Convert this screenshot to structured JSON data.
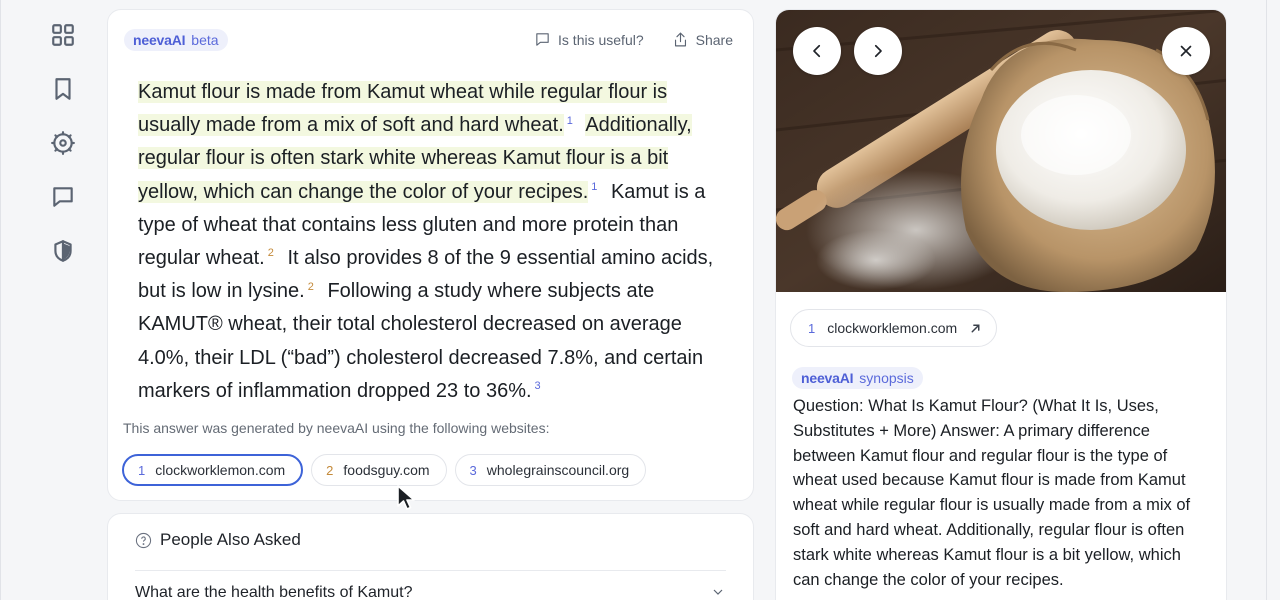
{
  "rail": {
    "icons": [
      "apps-grid-icon",
      "bookmark-icon",
      "settings-gear-icon",
      "feedback-chat-icon",
      "privacy-shield-icon"
    ]
  },
  "answer": {
    "brand": "neevaAI",
    "tag": "beta",
    "useful_label": "Is this useful?",
    "share_label": "Share",
    "segments": [
      {
        "text": "Kamut flour is made from Kamut wheat while regular flour is usually made from a mix of soft and hard wheat.",
        "cite": "1",
        "highlight": true
      },
      {
        "text": "Additionally, regular flour is often stark white whereas Kamut flour is a bit yellow, which can change the color of your recipes.",
        "cite": "1",
        "highlight": true
      },
      {
        "text": "Kamut is a type of wheat that contains less gluten and more protein than regular wheat.",
        "cite": "2",
        "highlight": false
      },
      {
        "text": "It also provides 8 of the 9 essential amino acids, but is low in lysine.",
        "cite": "2",
        "highlight": false
      },
      {
        "text": "Following a study where subjects ate KAMUT® wheat, their total cholesterol decreased on average 4.0%, their LDL (“bad”) cholesterol decreased 7.8%, and certain markers of inflammation dropped 23 to 36%.",
        "cite": "3",
        "highlight": false
      }
    ],
    "generated_note": "This answer was generated by neevaAI using the following websites:",
    "sources": [
      {
        "num": "1",
        "name": "clockworklemon.com"
      },
      {
        "num": "2",
        "name": "foodsguy.com"
      },
      {
        "num": "3",
        "name": "wholegrainscouncil.org"
      }
    ]
  },
  "paa": {
    "title": "People Also Asked",
    "question": "What are the health benefits of Kamut?"
  },
  "panel": {
    "source_num": "1",
    "source_name": "clockworklemon.com",
    "brand": "neevaAI",
    "tag": "synopsis",
    "synopsis": "Question: What Is Kamut Flour? (What It Is, Uses, Substitutes + More) Answer: A primary difference between Kamut flour and regular flour is the type of wheat used because Kamut flour is made from Kamut wheat while regular flour is usually made from a mix of soft and hard wheat. Additionally, regular flour is often stark white whereas Kamut flour is a bit yellow, which can change the color of your recipes."
  },
  "colors": {
    "accent": "#4e5fd6",
    "highlight": "#f3f8e0",
    "active_border": "#3d63d8"
  }
}
